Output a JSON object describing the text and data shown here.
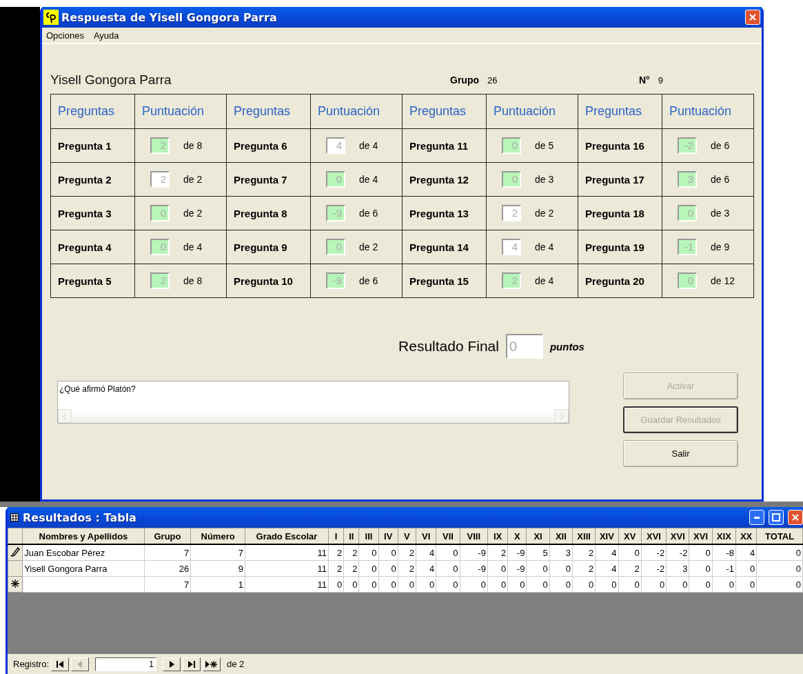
{
  "window": {
    "title": "Respuesta de Yisell Gongora Parra"
  },
  "menu": [
    {
      "label": "Opciones"
    },
    {
      "label": "Ayuda"
    }
  ],
  "student": {
    "name": "Yisell Gongora Parra",
    "group_label": "Grupo",
    "group": "26",
    "number_label": "N°",
    "number": "9"
  },
  "score_table": {
    "columns": [
      "Preguntas",
      "Puntuación",
      "Preguntas",
      "Puntuación",
      "Preguntas",
      "Puntuación",
      "Preguntas",
      "Puntuación"
    ],
    "questions": [
      {
        "label": "Pregunta 1",
        "score": "2",
        "max": "de 8",
        "highlighted": true
      },
      {
        "label": "Pregunta 2",
        "score": "2",
        "max": "de 2",
        "highlighted": false
      },
      {
        "label": "Pregunta 3",
        "score": "0",
        "max": "de 2",
        "highlighted": true
      },
      {
        "label": "Pregunta 4",
        "score": "0",
        "max": "de 4",
        "highlighted": true
      },
      {
        "label": "Pregunta 5",
        "score": "2",
        "max": "de 8",
        "highlighted": true
      },
      {
        "label": "Pregunta 6",
        "score": "4",
        "max": "de 4",
        "highlighted": false
      },
      {
        "label": "Pregunta 7",
        "score": "0",
        "max": "de 4",
        "highlighted": true
      },
      {
        "label": "Pregunta 8",
        "score": "-9",
        "max": "de 6",
        "highlighted": true
      },
      {
        "label": "Pregunta 9",
        "score": "0",
        "max": "de 2",
        "highlighted": true
      },
      {
        "label": "Pregunta 10",
        "score": "-9",
        "max": "de 6",
        "highlighted": true
      },
      {
        "label": "Pregunta 11",
        "score": "0",
        "max": "de 5",
        "highlighted": true
      },
      {
        "label": "Pregunta 12",
        "score": "0",
        "max": "de 3",
        "highlighted": true
      },
      {
        "label": "Pregunta 13",
        "score": "2",
        "max": "de 2",
        "highlighted": false
      },
      {
        "label": "Pregunta 14",
        "score": "4",
        "max": "de 4",
        "highlighted": false
      },
      {
        "label": "Pregunta 15",
        "score": "2",
        "max": "de 4",
        "highlighted": true
      },
      {
        "label": "Pregunta 16",
        "score": "-2",
        "max": "de 6",
        "highlighted": true
      },
      {
        "label": "Pregunta 17",
        "score": "3",
        "max": "de 6",
        "highlighted": true
      },
      {
        "label": "Pregunta 18",
        "score": "0",
        "max": "de 3",
        "highlighted": true
      },
      {
        "label": "Pregunta 19",
        "score": "-1",
        "max": "de 9",
        "highlighted": true
      },
      {
        "label": "Pregunta 20",
        "score": "0",
        "max": "de 12",
        "highlighted": true
      }
    ]
  },
  "result": {
    "label": "Resultado Final",
    "value": "0",
    "unit": "puntos"
  },
  "question_text": "¿Qué afirmó Platón?",
  "buttons": [
    {
      "label": "Activar",
      "disabled": true,
      "focused": false
    },
    {
      "label": "Guardar Resultados",
      "disabled": true,
      "focused": true
    },
    {
      "label": "Salir",
      "disabled": false,
      "focused": false
    }
  ],
  "datasheet": {
    "title": "Resultados : Tabla",
    "columns": [
      "Nombres y Apellidos",
      "Grupo",
      "Número",
      "Grado Escolar",
      "I",
      "II",
      "III",
      "IV",
      "V",
      "VI",
      "VII",
      "VIII",
      "IX",
      "X",
      "XI",
      "XII",
      "XIII",
      "XIV",
      "XV",
      "XVI",
      "XVI",
      "XVI",
      "XIX",
      "XX",
      "TOTAL"
    ],
    "rows": [
      {
        "kind": "editing",
        "cells": [
          "Juan Escobar Pérez",
          "7",
          "7",
          "11",
          "2",
          "2",
          "0",
          "0",
          "2",
          "4",
          "0",
          "-9",
          "2",
          "-9",
          "5",
          "3",
          "2",
          "4",
          "0",
          "-2",
          "-2",
          "0",
          "-8",
          "4",
          "0"
        ]
      },
      {
        "kind": "saved",
        "cells": [
          "Yisell Gongora Parra",
          "26",
          "9",
          "11",
          "2",
          "2",
          "0",
          "0",
          "2",
          "4",
          "0",
          "-9",
          "0",
          "-9",
          "0",
          "0",
          "2",
          "4",
          "2",
          "-2",
          "3",
          "0",
          "-1",
          "0",
          "0"
        ]
      },
      {
        "kind": "new",
        "cells": [
          "",
          "7",
          "1",
          "11",
          "0",
          "0",
          "0",
          "0",
          "0",
          "0",
          "0",
          "0",
          "0",
          "0",
          "0",
          "0",
          "0",
          "0",
          "0",
          "0",
          "0",
          "0",
          "0",
          "0",
          "0"
        ]
      }
    ],
    "navigator": {
      "label": "Registro:",
      "record": "1",
      "of": "de 2",
      "buttons": [
        {
          "kind": "first",
          "disabled": false
        },
        {
          "kind": "prev",
          "disabled": true
        },
        {
          "kind": "next",
          "disabled": false
        },
        {
          "kind": "last",
          "disabled": false
        },
        {
          "kind": "new",
          "disabled": false
        }
      ]
    }
  }
}
